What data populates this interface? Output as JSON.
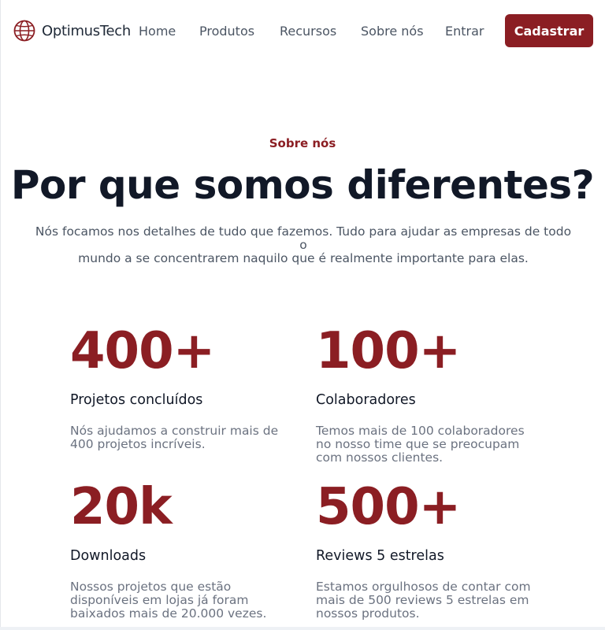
{
  "header": {
    "brand": "OptimusTech",
    "nav": {
      "home": "Home",
      "products": "Produtos",
      "resources": "Recursos",
      "about": "Sobre nós",
      "login": "Entrar"
    },
    "signup": "Cadastrar"
  },
  "hero": {
    "eyebrow": "Sobre nós",
    "title": "Por que somos diferentes?",
    "lead_line1": "Nós focamos nos detalhes de tudo que fazemos. Tudo para ajudar as empresas de todo o",
    "lead_line2": "mundo a se concentrarem naquilo que é realmente importante para elas."
  },
  "stats": [
    {
      "value": "400+",
      "label": "Projetos concluídos",
      "desc_lines": [
        "Nós ajudamos a construir mais de",
        "400 projetos incríveis."
      ]
    },
    {
      "value": "100+",
      "label": "Colaboradores",
      "desc_lines": [
        "Temos mais de 100 colaboradores",
        "no nosso time que se preocupam",
        "com nossos clientes."
      ]
    },
    {
      "value": "20k",
      "label": "Downloads",
      "desc_lines": [
        "Nossos projetos que estão",
        "disponíveis em lojas já foram",
        "baixados mais de 20.000 vezes."
      ]
    },
    {
      "value": "500+",
      "label": "Reviews 5 estrelas",
      "desc_lines": [
        "Estamos orgulhosos de contar com",
        "mais de 500 reviews 5 estrelas em",
        "nossos produtos."
      ]
    }
  ],
  "colors": {
    "accent": "#8b1e23",
    "text": "#111827",
    "muted": "#6b7280"
  },
  "icons": {
    "logo": "globe-icon"
  }
}
